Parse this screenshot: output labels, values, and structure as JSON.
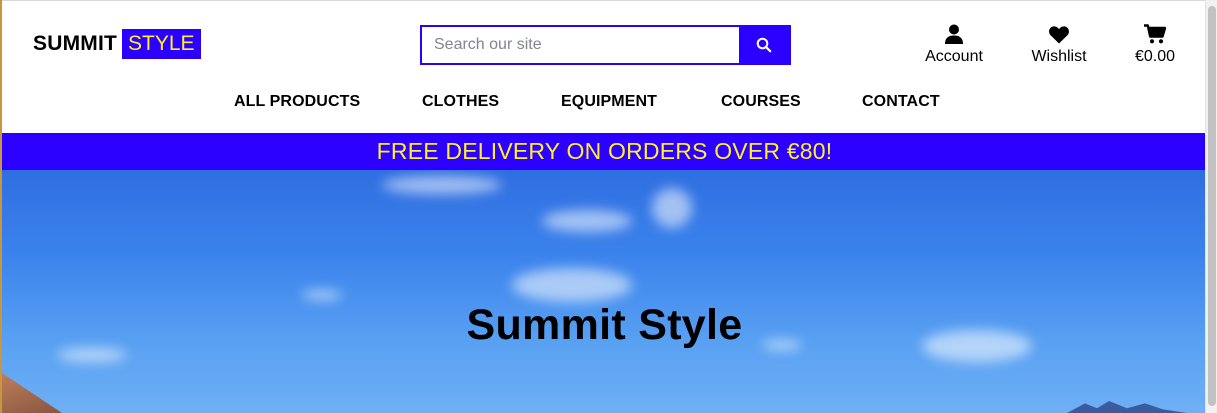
{
  "brand": {
    "word1": "SUMMIT",
    "word2": "STYLE"
  },
  "search": {
    "placeholder": "Search our site",
    "value": ""
  },
  "utility": {
    "account_label": "Account",
    "wishlist_label": "Wishlist",
    "cart_total": "€0.00"
  },
  "nav": {
    "items": [
      {
        "label": "ALL PRODUCTS"
      },
      {
        "label": "CLOTHES"
      },
      {
        "label": "EQUIPMENT"
      },
      {
        "label": "COURSES"
      },
      {
        "label": "CONTACT"
      }
    ]
  },
  "banner": {
    "text": "FREE DELIVERY ON ORDERS OVER €80!"
  },
  "hero": {
    "title": "Summit Style"
  },
  "colors": {
    "accent": "#2c00ff",
    "highlight": "#ffef2e",
    "text": "#000000"
  },
  "icons": {
    "search": "magnifier-icon",
    "account": "user-icon",
    "wishlist": "heart-icon",
    "cart": "cart-icon"
  }
}
